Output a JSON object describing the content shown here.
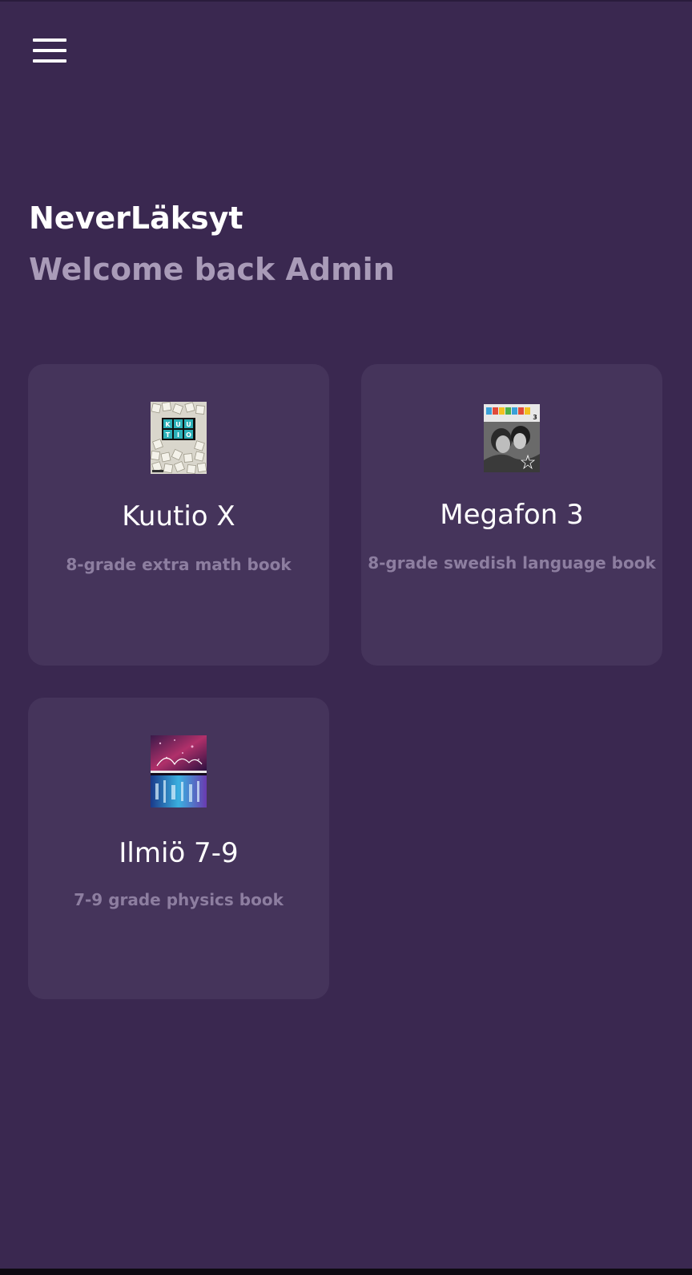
{
  "app": {
    "title": "NeverLäksyt",
    "welcome": "Welcome back Admin"
  },
  "icons": {
    "menu": "hamburger-menu-icon"
  },
  "colors": {
    "background": "#3a2850",
    "card": "#45345b",
    "title": "#ffffff",
    "subtitle": "#a99bb8",
    "description": "#8d7ea0"
  },
  "books": [
    {
      "title": "Kuutio X",
      "description": "8-grade extra math book"
    },
    {
      "title": "Megafon 3",
      "description": "8-grade swedish language book"
    },
    {
      "title": "Ilmiö 7-9",
      "description": "7-9 grade physics book"
    }
  ]
}
